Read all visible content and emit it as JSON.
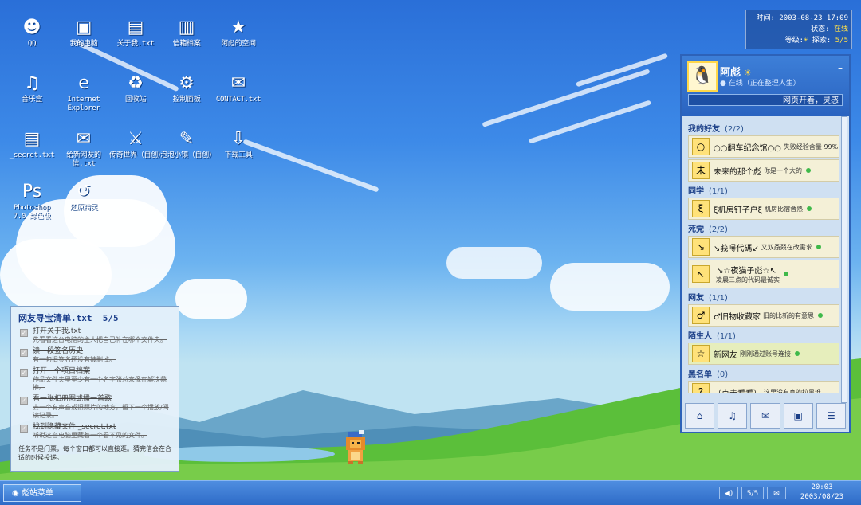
{
  "desktop_icons": [
    {
      "label": "QQ",
      "glyph": "☻",
      "icon": "qq-icon"
    },
    {
      "label": "我的电脑",
      "glyph": "▣",
      "icon": "computer-icon"
    },
    {
      "label": "关于我.txt",
      "glyph": "▤",
      "icon": "text-file-icon"
    },
    {
      "label": "信箱档案",
      "glyph": "▥",
      "icon": "archive-icon"
    },
    {
      "label": "阿彪的空间",
      "glyph": "★",
      "icon": "star-icon"
    },
    {
      "label": "音乐盒",
      "glyph": "♫",
      "icon": "music-icon"
    },
    {
      "label": "Internet Explorer",
      "glyph": "e",
      "icon": "ie-icon"
    },
    {
      "label": "回收站",
      "glyph": "♻",
      "icon": "recycle-bin-icon"
    },
    {
      "label": "控制面板",
      "glyph": "⚙",
      "icon": "gear-icon"
    },
    {
      "label": "CONTACT.txt",
      "glyph": "✉",
      "icon": "mail-icon"
    },
    {
      "label": "_secret.txt",
      "glyph": "▤",
      "icon": "secret-file-icon"
    },
    {
      "label": "给新网友的信.txt",
      "glyph": "✉",
      "icon": "letter-icon"
    },
    {
      "label": "传奇世界（自创）",
      "glyph": "⚔",
      "icon": "sword-icon"
    },
    {
      "label": "泡泡小镇（自创）",
      "glyph": "✎",
      "icon": "bubble-icon"
    },
    {
      "label": "下载工具",
      "glyph": "⇩",
      "icon": "download-icon"
    },
    {
      "label": "Photoshop 7.0 绿色版",
      "glyph": "Ps",
      "icon": "photoshop-icon"
    },
    {
      "label": "还原精灵",
      "glyph": "↺",
      "icon": "restore-icon"
    }
  ],
  "status": {
    "time_label": "时间:",
    "time": "2003-08-23 17:09",
    "state_label": "状态:",
    "state": "在线",
    "level_label": "等级:",
    "level_icon": "☀",
    "explore_label": "探索:",
    "explore": "5/5"
  },
  "qq": {
    "name": "阿彪",
    "online": "在线（正在整理人生）",
    "signature": "网页开着，灵感",
    "groups": [
      {
        "name": "我的好友",
        "count": "(2/2)",
        "friends": [
          {
            "avatar": "○",
            "name": "○○翻车纪念馆○○",
            "sig": "失败经验含量 99%"
          },
          {
            "avatar": "未",
            "name": "未来的那个彪",
            "sig": "你是一个大的"
          }
        ]
      },
      {
        "name": "同学",
        "count": "(1/1)",
        "friends": [
          {
            "avatar": "ξ",
            "name": "ξ机房钉子户ξ",
            "sig": "机房比宿舍熟"
          }
        ]
      },
      {
        "name": "死党",
        "count": "(2/2)",
        "friends": [
          {
            "avatar": "↘",
            "name": "↘莪噚代碼↙",
            "sig": "又双叒叕在改需求"
          },
          {
            "avatar": "↖",
            "name": "↘☆夜猫子彪☆↖",
            "sig": "凌晨三点的代码最诚实"
          }
        ]
      },
      {
        "name": "网友",
        "count": "(1/1)",
        "friends": [
          {
            "avatar": "♂",
            "name": "♂旧物收藏家",
            "sig": "旧的比新的有意思"
          }
        ]
      },
      {
        "name": "陌生人",
        "count": "(1/1)",
        "friends": [
          {
            "avatar": "☆",
            "name": "新网友",
            "sig": "刚刚通过账号连接"
          }
        ]
      },
      {
        "name": "黑名单",
        "count": "(0)",
        "friends": [
          {
            "avatar": "?",
            "name": "（点击看看）",
            "sig": "这里没有真的拉黑谁"
          }
        ]
      }
    ],
    "bottom_buttons": [
      "⌂",
      "♫",
      "✉",
      "▣",
      "☰"
    ]
  },
  "todo": {
    "title": "网友寻宝清单.txt",
    "progress": "5/5",
    "tasks": [
      {
        "title": "打开关于我.txt",
        "desc": "先看看这台电脑的主人把自己补在哪个文件夫。"
      },
      {
        "title": "读一段签名历史",
        "desc": "有一句旧签名还没有被删掉。"
      },
      {
        "title": "打开一个项目档案",
        "desc": "作品文件夫里至少有一个名字张总来像在解决鼎推。"
      },
      {
        "title": "看一张相册图或播一首歌",
        "desc": "去一个有声音或旧照片的地方，留下一个播放/阅读记录。"
      },
      {
        "title": "找到隐藏文件 _secret.txt",
        "desc": "听说这台电脑里藏着一个看不见的文件。"
      }
    ],
    "footer": "任务不是门票，每个窗口都可以直接逛。猜完信会在合适的时候投递。"
  },
  "taskbar": {
    "start_label": "彪站菜单",
    "tray_progress": "5/5",
    "clock_time": "20:03",
    "clock_date": "2003/08/23"
  },
  "colors": {
    "sky": "#3d8ae8",
    "grass": "#5bbf3a",
    "panel": "#cfe0f2",
    "accent": "#2d62b8",
    "online": "#3fb94a"
  }
}
